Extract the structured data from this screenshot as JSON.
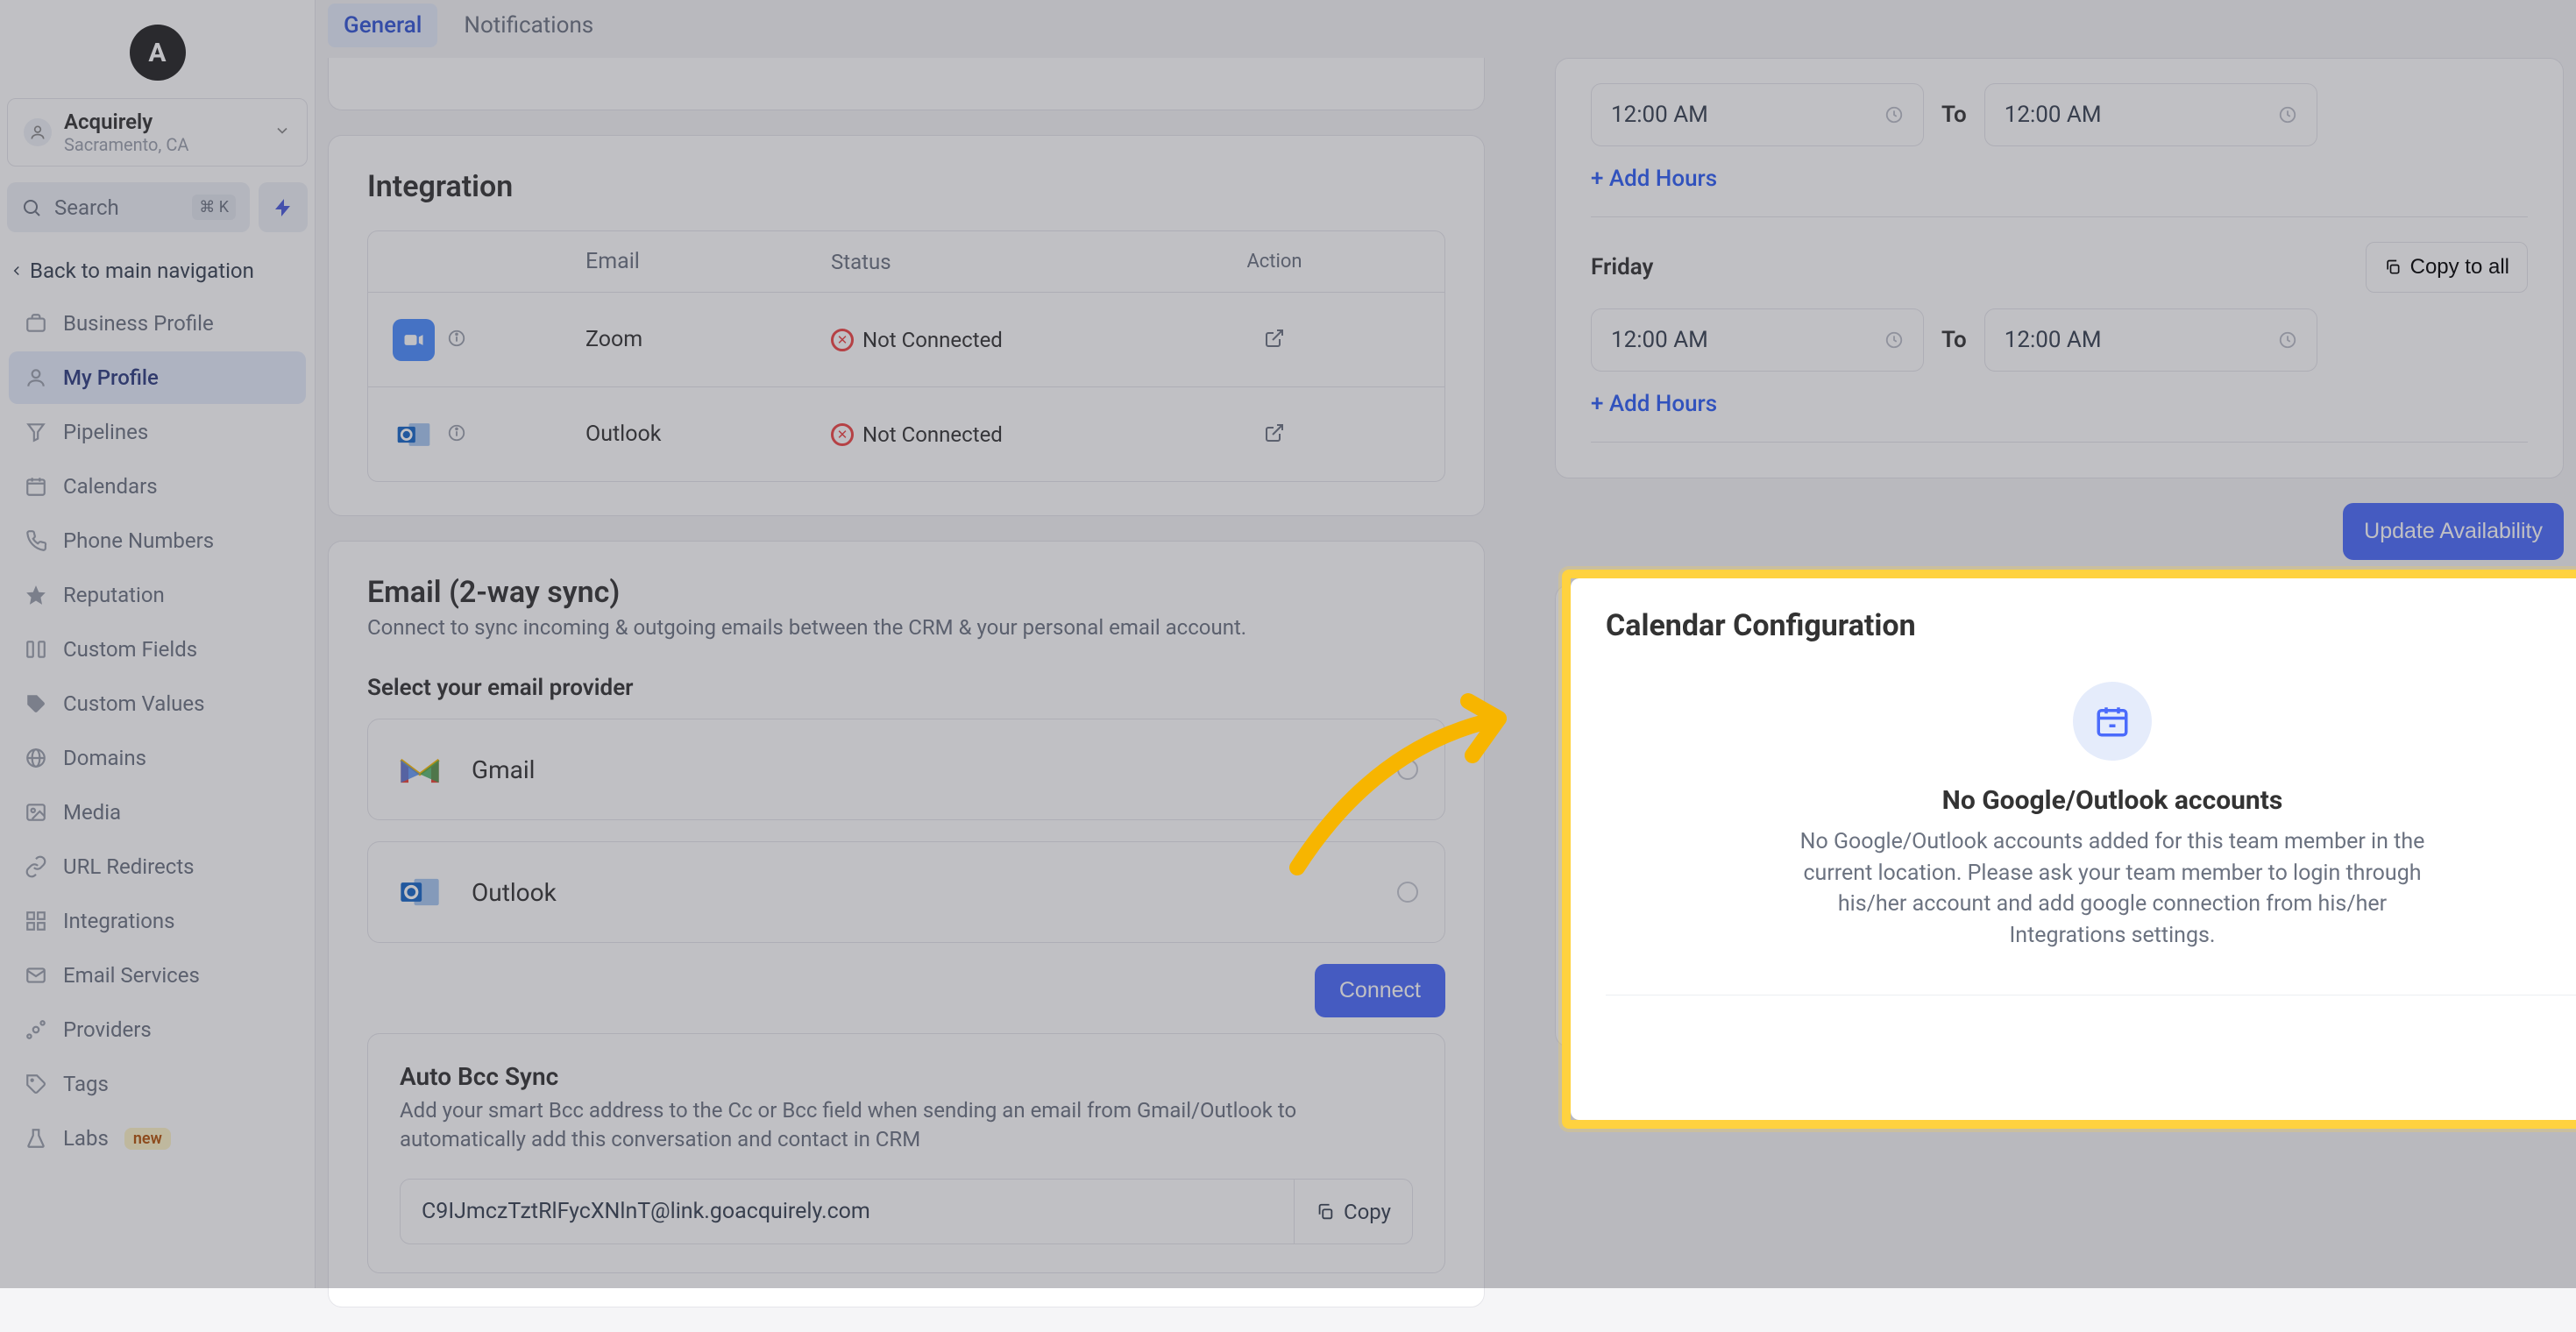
{
  "logoLetter": "A",
  "org": {
    "name": "Acquirely",
    "location": "Sacramento, CA"
  },
  "search": {
    "placeholder": "Search",
    "kbd": "⌘ K"
  },
  "backNav": "Back to main navigation",
  "nav": [
    {
      "label": "Business Profile"
    },
    {
      "label": "My Profile"
    },
    {
      "label": "Pipelines"
    },
    {
      "label": "Calendars"
    },
    {
      "label": "Phone Numbers"
    },
    {
      "label": "Reputation"
    },
    {
      "label": "Custom Fields"
    },
    {
      "label": "Custom Values"
    },
    {
      "label": "Domains"
    },
    {
      "label": "Media"
    },
    {
      "label": "URL Redirects"
    },
    {
      "label": "Integrations"
    },
    {
      "label": "Email Services"
    },
    {
      "label": "Providers"
    },
    {
      "label": "Tags"
    },
    {
      "label": "Labs",
      "badge": "new"
    }
  ],
  "tabs": {
    "general": "General",
    "notifications": "Notifications"
  },
  "integration": {
    "title": "Integration",
    "headers": {
      "email": "Email",
      "status": "Status",
      "action": "Action"
    },
    "rows": [
      {
        "app": "Zoom",
        "status": "Not Connected"
      },
      {
        "app": "Outlook",
        "status": "Not Connected"
      }
    ]
  },
  "emailSync": {
    "title": "Email (2-way sync)",
    "subtitle": "Connect to sync incoming & outgoing emails between the CRM & your personal email account.",
    "selectProvider": "Select your email provider",
    "providers": [
      {
        "name": "Gmail"
      },
      {
        "name": "Outlook"
      }
    ],
    "connectBtn": "Connect"
  },
  "autoBcc": {
    "title": "Auto Bcc Sync",
    "desc": "Add your smart Bcc address to the Cc or Bcc field when sending an email from Gmail/Outlook to automatically add this conversation and contact in CRM",
    "address": "C9IJmczTztRlFycXNlnT@link.goacquirely.com",
    "copy": "Copy"
  },
  "availability": {
    "thursday": {
      "from": "12:00 AM",
      "to": "12:00 AM"
    },
    "toLabel": "To",
    "addHours": "+ Add Hours",
    "fridayLabel": "Friday",
    "friday": {
      "from": "12:00 AM",
      "to": "12:00 AM"
    },
    "copyToAll": "Copy to all",
    "updateBtn": "Update Availability"
  },
  "calendarConfig": {
    "title": "Calendar Configuration",
    "emptyHead": "No Google/Outlook accounts",
    "emptyDesc": "No Google/Outlook accounts added for this team member in the current location. Please ask your team member to login through his/her account and add google connection from his/her Integrations settings."
  }
}
